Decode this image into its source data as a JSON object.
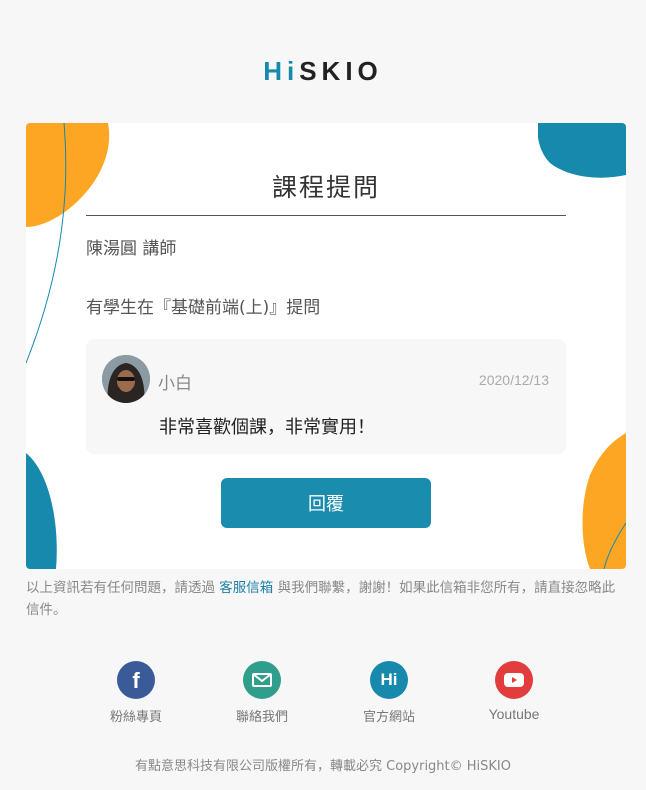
{
  "brand": {
    "logo_hi": "Hi",
    "logo_rest": "SKIO"
  },
  "email": {
    "title": "課程提問",
    "teacher": "陳湯圓 講師",
    "notice": "有學生在『基礎前端(上)』提問",
    "question": {
      "user": "小白",
      "date": "2020/12/13",
      "text": "非常喜歡個課，非常實用！"
    },
    "reply_label": "回覆"
  },
  "footnote": {
    "before": "以上資訊若有任何問題，請透過 ",
    "link": "客服信箱",
    "after": " 與我們聯繫，謝謝！如果此信箱非您所有，請直接忽略此信件。"
  },
  "social": [
    {
      "label": "粉絲專頁",
      "icon": "facebook-icon",
      "color": "#3b5a98",
      "glyph": "f"
    },
    {
      "label": "聯絡我們",
      "icon": "mail-icon",
      "color": "#2f9e8c"
    },
    {
      "label": "官方網站",
      "icon": "hiskio-hi-icon",
      "color": "#1789ad",
      "glyph": "Hi"
    },
    {
      "label": "Youtube",
      "icon": "youtube-icon",
      "color": "#e23d3d"
    }
  ],
  "copyright": "有點意思科技有限公司版權所有，轉載必究 Copyright© HiSKIO",
  "colors": {
    "accent": "#1a8dae",
    "orange": "#fda623",
    "teal": "#1789ad"
  }
}
